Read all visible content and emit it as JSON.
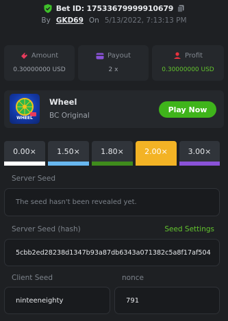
{
  "header": {
    "bet_label": "Bet ID:",
    "bet_id": "17533679999910679",
    "by_label": "By",
    "username": "GKD69",
    "on_label": "On",
    "date": "5/13/2022, 7:13:13 PM"
  },
  "stats": [
    {
      "label": "Amount",
      "value": "0.30000000 USD"
    },
    {
      "label": "Payout",
      "value": "2 x"
    },
    {
      "label": "Profit",
      "value": "0.30000000 USD"
    }
  ],
  "game": {
    "name": "Wheel",
    "provider": "BC Original",
    "thumb_text": "WHEEL",
    "play_label": "Play Now"
  },
  "multipliers": [
    {
      "label": "0.00×",
      "color": "#ffffff",
      "selected": false
    },
    {
      "label": "1.50×",
      "color": "#68b7ef",
      "selected": false
    },
    {
      "label": "1.80×",
      "color": "#3f8c1c",
      "selected": false
    },
    {
      "label": "2.00×",
      "color": "#f3b325",
      "selected": true
    },
    {
      "label": "3.00×",
      "color": "#8a52d8",
      "selected": false
    }
  ],
  "server_seed": {
    "label": "Server Seed",
    "placeholder": "The seed hasn't been revealed yet."
  },
  "server_seed_hash": {
    "label": "Server Seed (hash)",
    "settings_link": "Seed Settings",
    "value": "5cbb2ed28238d1347b93a87db6343a071382c5a8f17af504"
  },
  "client_seed": {
    "label": "Client Seed",
    "value": "ninteeneighty"
  },
  "nonce": {
    "label": "nonce",
    "value": "791"
  },
  "colors": {
    "accent_green": "#3fb41b",
    "selected_yellow": "#f3b325",
    "background": "#1e2023"
  }
}
